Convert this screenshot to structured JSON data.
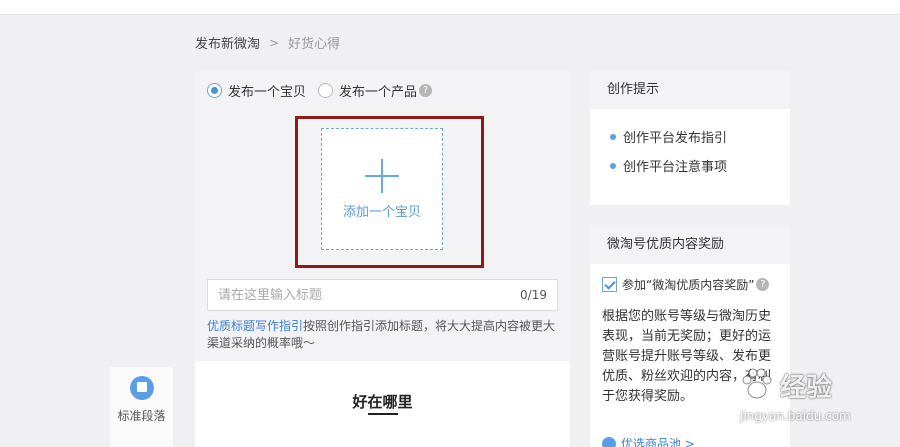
{
  "breadcrumb": {
    "root": "发布新微淘",
    "separator": ">",
    "current": "好货心得"
  },
  "publish_type": {
    "option_item": "发布一个宝贝",
    "option_product": "发布一个产品",
    "selected": "发布一个宝贝",
    "help_glyph": "?"
  },
  "add_item": {
    "label": "添加一个宝贝",
    "icon": "plus-icon"
  },
  "title_input": {
    "placeholder": "请在这里输入标题",
    "value": "",
    "counter": "0/19"
  },
  "title_tip": {
    "link": "优质标题写作指引",
    "text": "按照创作指引添加标题，将大大提高内容被更大渠道采纳的概率哦～"
  },
  "content_section": {
    "heading": "好在哪里"
  },
  "tool_panel": {
    "label": "标准段落"
  },
  "tips_card": {
    "title": "创作提示",
    "items": [
      "创作平台发布指引",
      "创作平台注意事项"
    ]
  },
  "reward_card": {
    "title": "微淘号优质内容奖励",
    "checkbox_label": "参加“微淘优质内容奖励”",
    "checkbox_checked": true,
    "help_glyph": "?",
    "description": "根据您的账号等级与微淘历史表现，当前无奖励；更好的运营账号提升账号等级、发布更优质、粉丝欢迎的内容，有利于您获得奖励。",
    "pool_link": "优选商品池 >"
  },
  "watermark": {
    "text": "经验",
    "url": "jingyan.baidu.com"
  },
  "colors": {
    "accent": "#4a90d9",
    "highlight_border": "#8e1b1b",
    "background": "#f0f0f2"
  }
}
